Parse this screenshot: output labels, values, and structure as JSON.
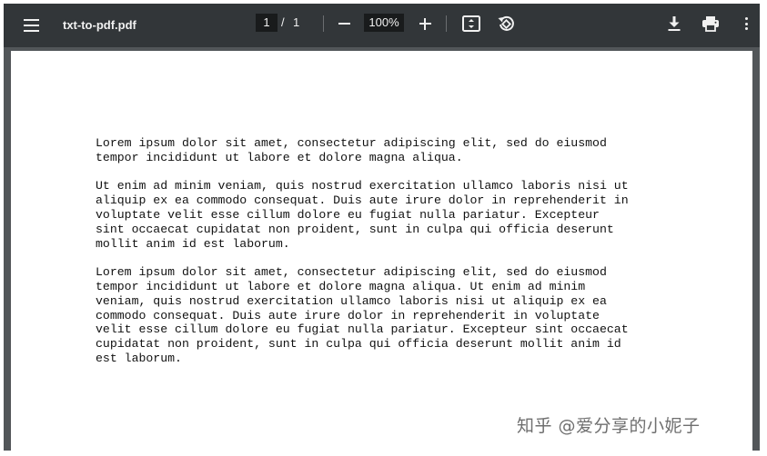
{
  "toolbar": {
    "menu_icon": "hamburger-menu-icon",
    "title": "txt-to-pdf.pdf",
    "page_current": "1",
    "page_separator": "/",
    "page_total": "1",
    "zoom_out_icon": "minus-icon",
    "zoom_level": "100%",
    "zoom_in_icon": "plus-icon",
    "fit_icon": "fit-to-page-icon",
    "rotate_icon": "rotate-counterclockwise-icon",
    "download_icon": "download-icon",
    "print_icon": "print-icon",
    "more_icon": "more-vertical-icon"
  },
  "document": {
    "paragraphs": [
      "Lorem ipsum dolor sit amet, consectetur adipiscing elit, sed do eiusmod\ntempor incididunt ut labore et dolore magna aliqua.",
      "Ut enim ad minim veniam, quis nostrud exercitation ullamco laboris nisi ut\naliquip ex ea commodo consequat. Duis aute irure dolor in reprehenderit in\nvoluptate velit esse cillum dolore eu fugiat nulla pariatur. Excepteur\nsint occaecat cupidatat non proident, sunt in culpa qui officia deserunt\nmollit anim id est laborum.",
      "Lorem ipsum dolor sit amet, consectetur adipiscing elit, sed do eiusmod\ntempor incididunt ut labore et dolore magna aliqua. Ut enim ad minim\nveniam, quis nostrud exercitation ullamco laboris nisi ut aliquip ex ea\ncommodo consequat. Duis aute irure dolor in reprehenderit in voluptate\nvelit esse cillum dolore eu fugiat nulla pariatur. Excepteur sint occaecat\ncupidatat non proident, sunt in culpa qui officia deserunt mollit anim id\nest laborum."
    ]
  },
  "watermark": "知乎 @爱分享的小妮子",
  "colors": {
    "toolbar_bg": "#323639",
    "viewer_bg": "#525659",
    "page_bg": "#ffffff",
    "input_bg": "#191b1c"
  }
}
